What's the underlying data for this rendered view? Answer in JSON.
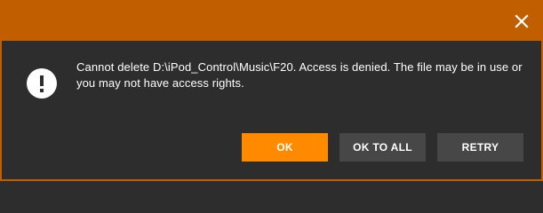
{
  "dialog": {
    "message": "Cannot delete D:\\iPod_Control\\Music\\F20. Access is denied. The file may be in use or you may not have access rights.",
    "icon": "exclamation-icon",
    "close_icon": "close-icon"
  },
  "buttons": {
    "ok_label": "OK",
    "ok_to_all_label": "OK TO ALL",
    "retry_label": "RETRY"
  },
  "colors": {
    "titlebar": "#c15f00",
    "primary_button": "#ff8a00",
    "secondary_button": "#474747",
    "background": "#2d2d2d"
  }
}
